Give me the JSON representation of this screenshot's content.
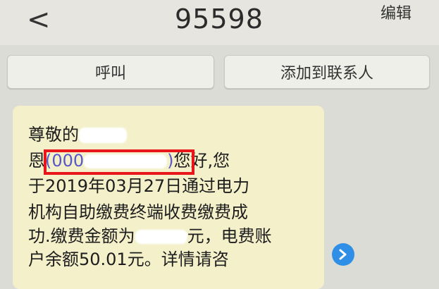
{
  "header": {
    "back_glyph": "<",
    "title": "95598",
    "edit_label": "编辑"
  },
  "actions": {
    "call_label": "呼叫",
    "add_contact_label": "添加到联系人"
  },
  "message": {
    "line1_prefix": "尊敬的",
    "line2_prefix": "恩",
    "account_visible": "(000",
    "account_suffix": ")",
    "line2_tail": "您好,您",
    "line3": "于2019年03月27日通过电力",
    "line4": "机构自助缴费终端收费缴费成",
    "line5_prefix": "功.缴费金额为",
    "line5_tail": "元，电费账",
    "line6": "户余额50.01元。详情请咨"
  },
  "colors": {
    "highlight_border": "#e8151b",
    "account_text": "#5a57c8",
    "bubble_bg": "#f3f0ca",
    "arrow_bg": "#2f8ee6"
  },
  "icons": {
    "back": "chevron-left-icon",
    "next": "chevron-right-icon"
  }
}
